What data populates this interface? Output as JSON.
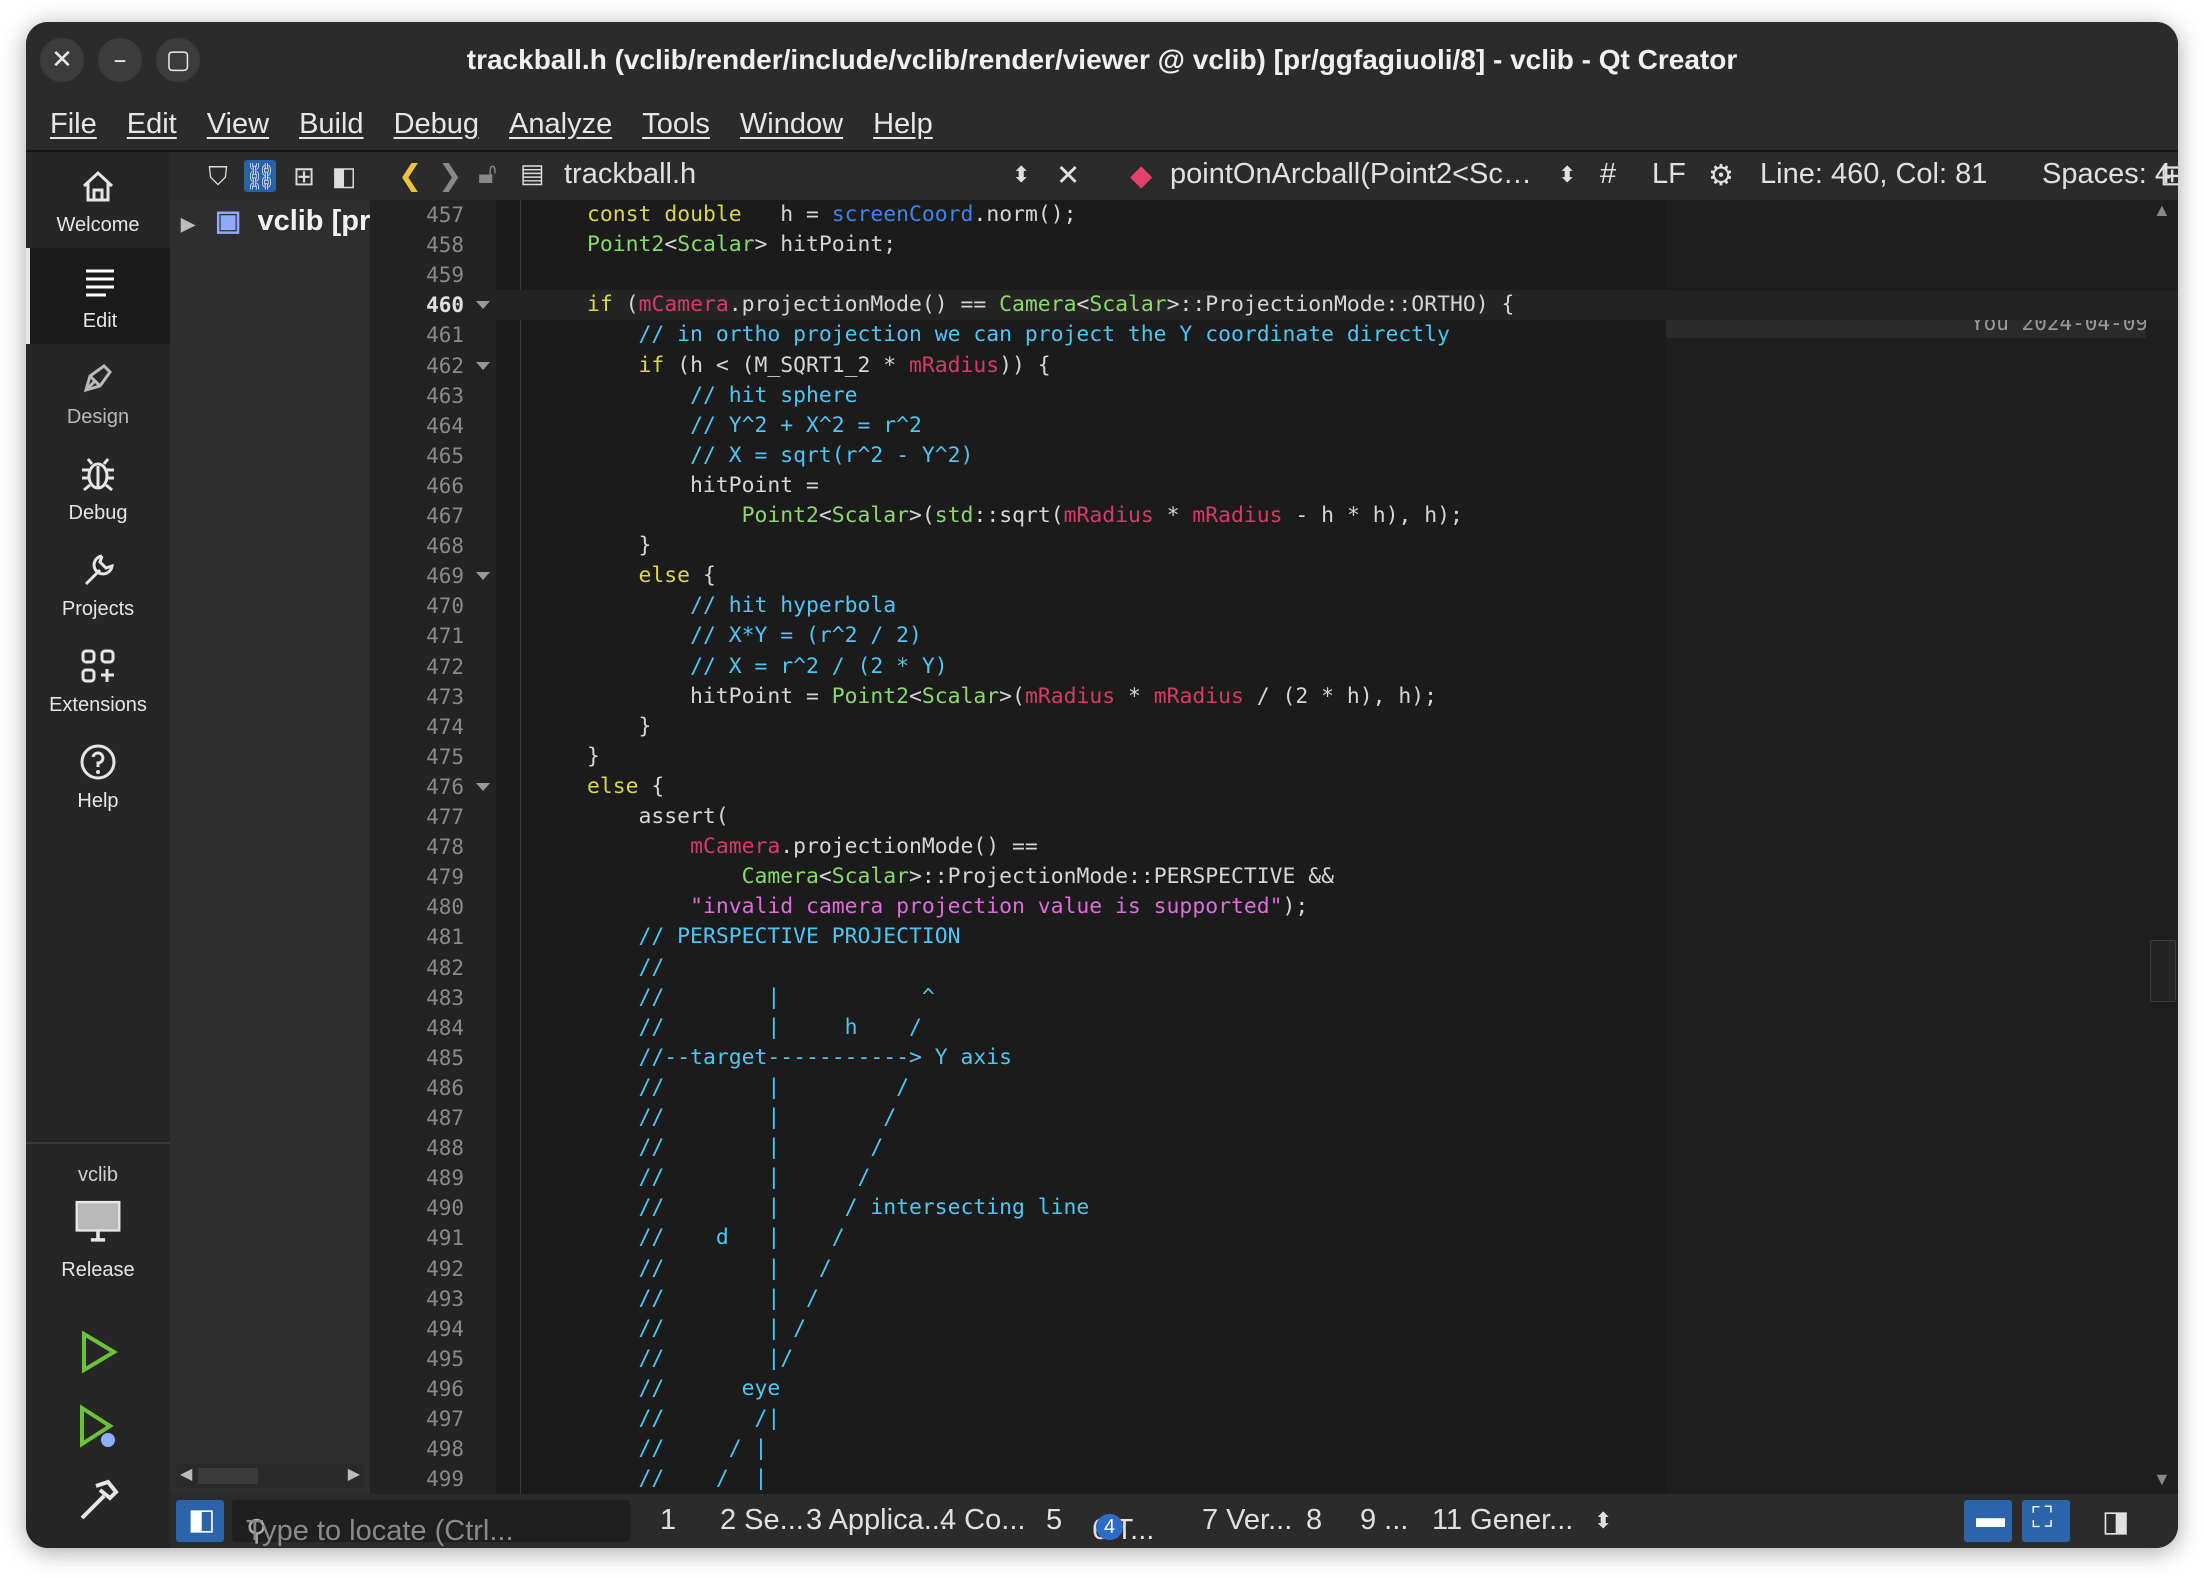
{
  "window": {
    "title": "trackball.h (vclib/render/include/vclib/render/viewer @ vclib) [pr/ggfagiuoli/8] - vclib - Qt Creator",
    "close": "✕",
    "minimize": "–",
    "maximize": "▢"
  },
  "menu": [
    "File",
    "Edit",
    "View",
    "Build",
    "Debug",
    "Analyze",
    "Tools",
    "Window",
    "Help"
  ],
  "modes": {
    "welcome": "Welcome",
    "edit": "Edit",
    "design": "Design",
    "debug": "Debug",
    "projects": "Projects",
    "extensions": "Extensions",
    "help": "Help",
    "kit_project": "vclib",
    "kit_build": "Release"
  },
  "project_tree": {
    "root": "vclib [pr"
  },
  "editor_toolbar": {
    "file_name": "trackball.h",
    "symbol": "pointOnArcball(Point2<Sc…",
    "hash": "#",
    "line_ending": "LF",
    "position": "Line: 460, Col: 81",
    "indent": "Spaces: 4"
  },
  "blame": "You 2024-04-09",
  "line_numbers": [
    "457",
    "458",
    "459",
    "460",
    "461",
    "462",
    "463",
    "464",
    "465",
    "466",
    "467",
    "468",
    "469",
    "470",
    "471",
    "472",
    "473",
    "474",
    "475",
    "476",
    "477",
    "478",
    "479",
    "480",
    "481",
    "482",
    "483",
    "484",
    "485",
    "486",
    "487",
    "488",
    "489",
    "490",
    "491",
    "492",
    "493",
    "494",
    "495",
    "496",
    "497",
    "498",
    "499"
  ],
  "code_lines": [
    "        const double   h = screenCoord.norm();",
    "        Point2<Scalar> hitPoint;",
    "",
    "        if (mCamera.projectionMode() == Camera<Scalar>::ProjectionMode::ORTHO) {",
    "            // in ortho projection we can project the Y coordinate directly",
    "            if (h < (M_SQRT1_2 * mRadius)) {",
    "                // hit sphere",
    "                // Y^2 + X^2 = r^2",
    "                // X = sqrt(r^2 - Y^2)",
    "                hitPoint =",
    "                    Point2<Scalar>(std::sqrt(mRadius * mRadius - h * h), h);",
    "            }",
    "            else {",
    "                // hit hyperbola",
    "                // X*Y = (r^2 / 2)",
    "                // X = r^2 / (2 * Y)",
    "                hitPoint = Point2<Scalar>(mRadius * mRadius / (2 * h), h);",
    "            }",
    "        }",
    "        else {",
    "            assert(",
    "                mCamera.projectionMode() ==",
    "                    Camera<Scalar>::ProjectionMode::PERSPECTIVE &&",
    "                \"invalid camera projection value is supported\");",
    "            // PERSPECTIVE PROJECTION",
    "            //",
    "            //        |           ^",
    "            //        |     h    /",
    "            //--target-----------> Y axis",
    "            //        |         /",
    "            //        |        /",
    "            //        |       /",
    "            //        |      /",
    "            //        |     / intersecting line",
    "            //    d   |    /",
    "            //        |   /",
    "            //        |  /",
    "            //        | /",
    "            //        |/",
    "            //      eye",
    "            //       /|",
    "            //     / |",
    "            //    /  |"
  ],
  "status_bar": {
    "locate_placeholder": "Type to locate (Ctrl...",
    "panes": [
      "1",
      "2 Se...",
      "3  Applica...",
      "4  Co...",
      "5",
      "6  T...",
      "7  Ver...",
      "8",
      "9  ...",
      "11 Gener..."
    ],
    "issues_badge": "4"
  }
}
